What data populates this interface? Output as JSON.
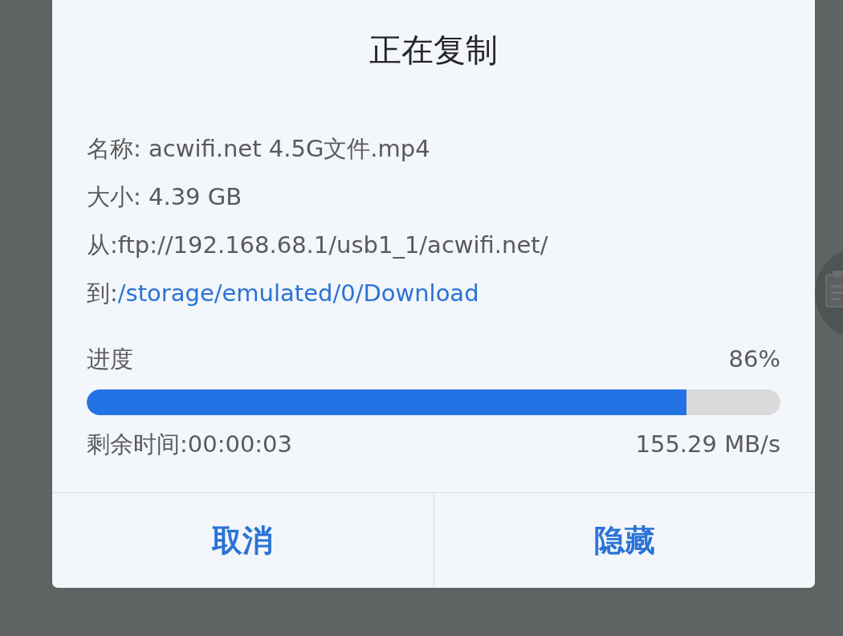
{
  "dialog": {
    "title": "正在复制",
    "details": [
      {
        "kind": "text",
        "text": "名称: acwifi.net 4.5G文件.mp4"
      },
      {
        "kind": "text",
        "text": "大小: 4.39 GB"
      },
      {
        "kind": "text",
        "text": "从:ftp://192.168.68.1/usb1_1/acwifi.net/"
      },
      {
        "kind": "link",
        "label": "到:",
        "value": "/storage/emulated/0/Download"
      }
    ],
    "progress": {
      "label": "进度",
      "percent": "86%",
      "level": 0.865,
      "remaining": "剩余时间:00:00:03",
      "speed": "155.29 MB/s"
    },
    "buttons": [
      {
        "label": "取消"
      },
      {
        "label": "隐藏"
      }
    ]
  }
}
